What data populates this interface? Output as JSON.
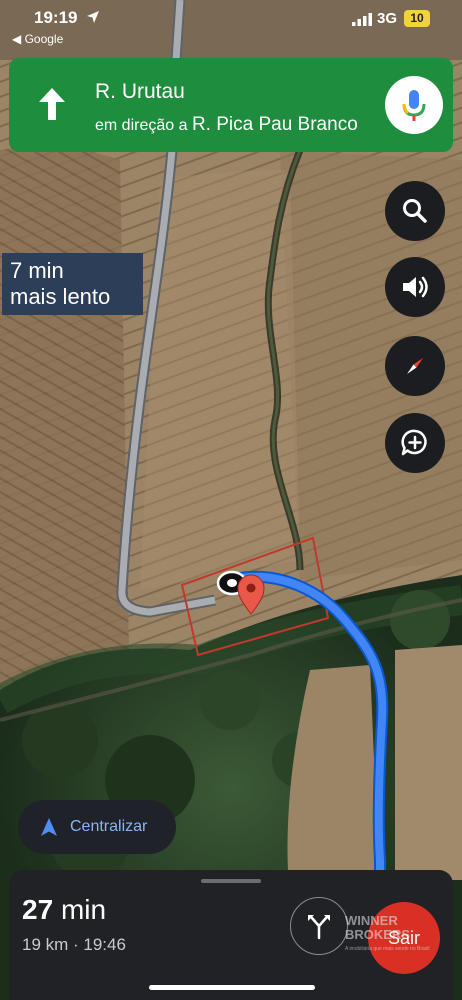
{
  "status_bar": {
    "time": "19:19",
    "back_app": "◀ Google",
    "network": "3G",
    "battery": "10"
  },
  "navigation": {
    "street": "R. Urutau",
    "toward_prefix": "em direção a",
    "toward_street": "R. Pica Pau Branco"
  },
  "map": {
    "route_color": "#1a73e8",
    "alt_road_color": "#9aa0a6",
    "boundary_color": "#c0392b",
    "pin_color": "#e8594a",
    "slower_label_line1": "7 min",
    "slower_label_line2": "mais lento"
  },
  "controls": {
    "search_icon": "search-icon",
    "sound_icon": "speaker-icon",
    "compass_icon": "compass-icon",
    "report_icon": "add-report-icon",
    "recenter_label": "Centralizar"
  },
  "trip": {
    "eta_minutes": "27",
    "eta_unit": "min",
    "distance_arrival": "19 km · 19:46",
    "exit_label": "Sair"
  },
  "watermark": {
    "line1": "WINNER",
    "line2": "BROKERS",
    "line3": "A imobiliária que mais vende no Brasil"
  }
}
